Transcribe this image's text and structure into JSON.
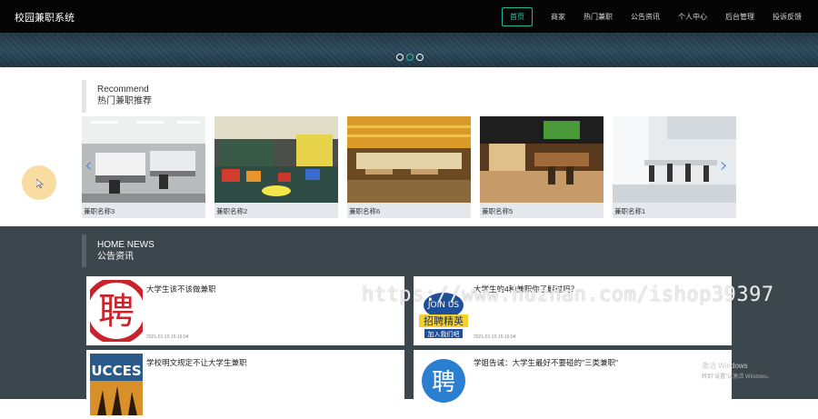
{
  "header": {
    "brand": "校园兼职系统",
    "nav": [
      "首页",
      "商家",
      "热门兼职",
      "公告资讯",
      "个人中心",
      "后台管理",
      "投诉反馈"
    ]
  },
  "recommend": {
    "en": "Recommend",
    "cn": "热门兼职推荐",
    "items": [
      {
        "label": "兼职名称3"
      },
      {
        "label": "兼职名称2"
      },
      {
        "label": "兼职名称6"
      },
      {
        "label": "兼职名称5"
      },
      {
        "label": "兼职名称1"
      }
    ]
  },
  "news": {
    "en": "HOME NEWS",
    "cn": "公告资讯",
    "items": [
      {
        "title": "大学生该不该做兼职",
        "date": "2021-01-19 15:16:04"
      },
      {
        "title": "大学生的4种兼职你了解过吗？",
        "date": "2021-01-19 15:16:04"
      },
      {
        "title": "学校明文规定不让大学生兼职",
        "date": ""
      },
      {
        "title": "学姐告诫：大学生最好不要碰的\"三类兼职\"",
        "date": ""
      }
    ],
    "thumbs": {
      "t1": "聘",
      "t2a": "JOIN US",
      "t2b": "招聘精英",
      "t2c": "加入我们吧",
      "t3": "UCCES",
      "t4": "聘"
    }
  },
  "watermark": "https://www.huzhan.com/ishop39397",
  "windows": {
    "line1": "激活 Windows",
    "line2": "转到\"设置\"以激活 Windows。"
  },
  "colors": {
    "accent": "#1fb89b",
    "nav_bg": "#050505",
    "news_bg": "#3b464d",
    "arrow": "#2f80ed"
  }
}
